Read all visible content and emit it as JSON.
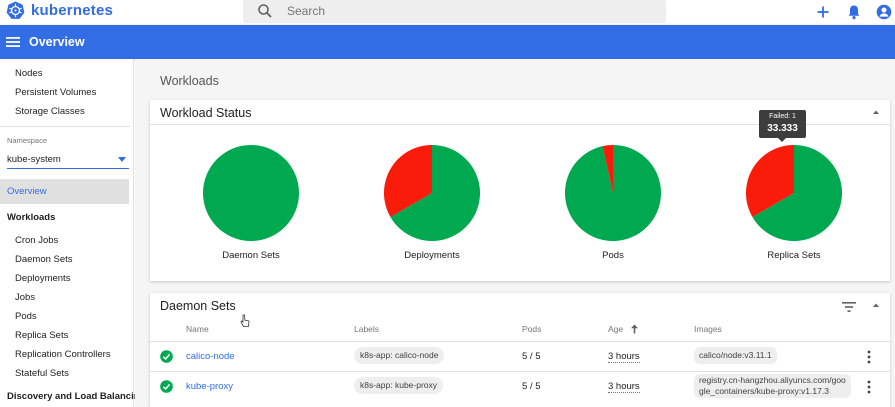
{
  "header": {
    "brand": "kubernetes",
    "search_placeholder": "Search"
  },
  "toolbar": {
    "title": "Overview"
  },
  "sidebar": {
    "cluster_items": [
      {
        "label": "Nodes"
      },
      {
        "label": "Persistent Volumes"
      },
      {
        "label": "Storage Classes"
      }
    ],
    "namespace_label": "Namespace",
    "namespace_value": "kube-system",
    "overview": "Overview",
    "workloads_heading": "Workloads",
    "workload_items": [
      {
        "label": "Cron Jobs"
      },
      {
        "label": "Daemon Sets"
      },
      {
        "label": "Deployments"
      },
      {
        "label": "Jobs"
      },
      {
        "label": "Pods"
      },
      {
        "label": "Replica Sets"
      },
      {
        "label": "Replication Controllers"
      },
      {
        "label": "Stateful Sets"
      }
    ],
    "discovery_heading": "Discovery and Load Balancing"
  },
  "main": {
    "page_heading": "Workloads",
    "workload_status": {
      "title": "Workload Status",
      "tooltip_label": "Failed: 1",
      "tooltip_value": "33.333"
    },
    "daemon_sets": {
      "title": "Daemon Sets",
      "columns": [
        "Name",
        "Labels",
        "Pods",
        "Age",
        "Images"
      ],
      "rows": [
        {
          "name": "calico-node",
          "label": "k8s-app: calico-node",
          "pods": "5 / 5",
          "age": "3 hours",
          "image_1": "calico/node:v3.11.1",
          "image_2": ""
        },
        {
          "name": "kube-proxy",
          "label": "k8s-app: kube-proxy",
          "pods": "5 / 5",
          "age": "3 hours",
          "image_1": "registry.cn-hangzhou.aliyuncs.com/goo",
          "image_2": "gle_containers/kube-proxy:v1.17.3"
        }
      ]
    }
  },
  "colors": {
    "brand": "#326ce5",
    "running": "#00a94f",
    "failed": "#f91c0b",
    "toolbar": "#326de6"
  },
  "chart_data": [
    {
      "type": "pie",
      "title": "Daemon Sets",
      "labels": [
        "Running",
        "Failed"
      ],
      "values": [
        100,
        0
      ]
    },
    {
      "type": "pie",
      "title": "Deployments",
      "labels": [
        "Running",
        "Failed"
      ],
      "values": [
        66.667,
        33.333
      ]
    },
    {
      "type": "pie",
      "title": "Pods",
      "labels": [
        "Running",
        "Failed"
      ],
      "values": [
        96.5,
        3.5
      ]
    },
    {
      "type": "pie",
      "title": "Replica Sets",
      "labels": [
        "Running",
        "Failed"
      ],
      "values": [
        66.667,
        33.333
      ]
    }
  ]
}
